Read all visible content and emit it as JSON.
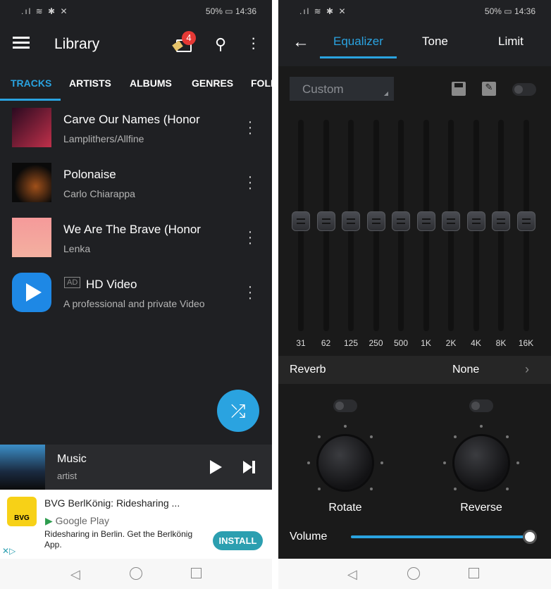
{
  "status": {
    "battery": "50%",
    "time": "14:36"
  },
  "library": {
    "title": "Library",
    "badge": "4",
    "tabs": [
      "TRACKS",
      "ARTISTS",
      "ALBUMS",
      "GENRES",
      "FOLDERS"
    ],
    "tracks": [
      {
        "title": "Carve Our Names (Honor",
        "subtitle": "Lamplithers/Allfine"
      },
      {
        "title": "Polonaise",
        "subtitle": "Carlo Chiarappa"
      },
      {
        "title": "We Are The Brave (Honor",
        "subtitle": "Lenka"
      },
      {
        "title": "HD Video",
        "subtitle": "A professional and private Video",
        "ad": "AD"
      }
    ],
    "player": {
      "title": "Music",
      "artist": "artist"
    },
    "ad": {
      "title": "BVG BerlKönig: Ridesharing ...",
      "store": "Google Play",
      "desc": "Ridesharing in Berlin. Get the Berlkönig App.",
      "install": "INSTALL",
      "logo": "BVG"
    }
  },
  "eq": {
    "tabs": [
      "Equalizer",
      "Tone",
      "Limit"
    ],
    "preset": "Custom",
    "bands": [
      "31",
      "62",
      "125",
      "250",
      "500",
      "1K",
      "2K",
      "4K",
      "8K",
      "16K"
    ],
    "band_levels_db": [
      0,
      0,
      0,
      0,
      0,
      0,
      0,
      0,
      0,
      0
    ],
    "reverb_label": "Reverb",
    "reverb_value": "None",
    "knobs": [
      "Rotate",
      "Reverse"
    ],
    "volume_label": "Volume",
    "volume_percent": 100,
    "accent": "#2aa3e0"
  }
}
